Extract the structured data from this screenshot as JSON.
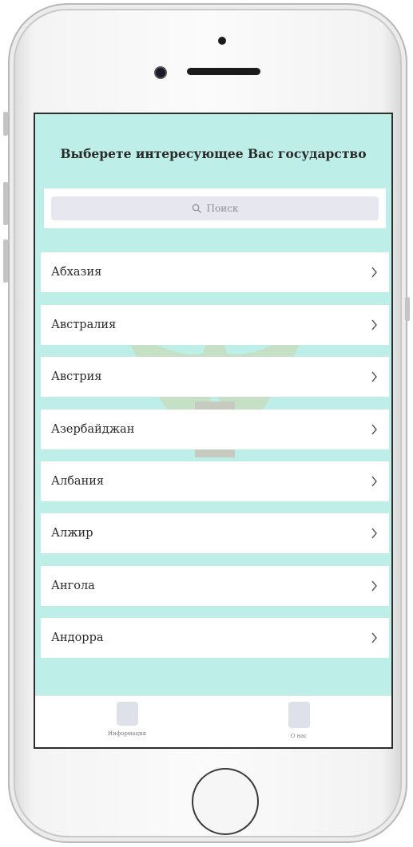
{
  "screen": {
    "title": "Выберете интересующее Вас государство",
    "search": {
      "placeholder": "Поиск",
      "icon": "search-icon"
    },
    "countries": [
      {
        "label": "Абхазия"
      },
      {
        "label": "Австралия"
      },
      {
        "label": "Австрия"
      },
      {
        "label": "Азербайджан"
      },
      {
        "label": "Албания"
      },
      {
        "label": "Алжир"
      },
      {
        "label": "Ангола"
      },
      {
        "label": "Андорра"
      }
    ],
    "tabs": [
      {
        "label": "Информация",
        "icon": "info-tab-icon"
      },
      {
        "label": "О нас",
        "icon": "about-tab-icon"
      }
    ]
  },
  "colors": {
    "background": "#bdeee8",
    "row": "#ffffff",
    "search_field": "#e7e8ef",
    "tab_icon": "#dfe1ea"
  }
}
